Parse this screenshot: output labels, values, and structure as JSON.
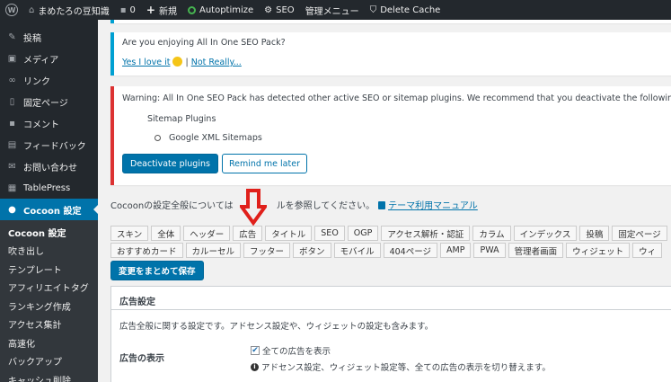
{
  "adminbar": {
    "site_name": "まめたろの豆知識",
    "comments_count": "0",
    "new_label": "新規",
    "autoptimize_label": "Autoptimize",
    "seo_label": "SEO",
    "admin_menu_label": "管理メニュー",
    "delete_cache_label": "Delete Cache"
  },
  "sidebar": {
    "items": [
      {
        "label": "投稿",
        "icon": "pin-icon"
      },
      {
        "label": "メディア",
        "icon": "media-icon"
      },
      {
        "label": "リンク",
        "icon": "link-icon"
      },
      {
        "label": "固定ページ",
        "icon": "page-icon"
      },
      {
        "label": "コメント",
        "icon": "comment-icon"
      },
      {
        "label": "フィードバック",
        "icon": "feedback-icon"
      },
      {
        "label": "お問い合わせ",
        "icon": "mail-icon"
      },
      {
        "label": "TablePress",
        "icon": "table-icon"
      },
      {
        "label": "Cocoon 設定",
        "icon": "cocoon-icon"
      }
    ],
    "submenu": [
      "Cocoon 設定",
      "吹き出し",
      "テンプレート",
      "アフィリエイトタグ",
      "ランキング作成",
      "アクセス集計",
      "高速化",
      "バックアップ",
      "キャッシュ削除"
    ]
  },
  "notice_seo": {
    "question": "Are you enjoying All In One SEO Pack?",
    "yes_link": "Yes I love it",
    "separator": "|",
    "no_link": "Not Really..."
  },
  "notice_warning": {
    "text": "Warning: All In One SEO Pack has detected other active SEO or sitemap plugins. We recommend that you deactivate the following plugins t",
    "heading": "Sitemap Plugins",
    "plugin": "Google XML Sitemaps",
    "deactivate_btn": "Deactivate plugins",
    "remind_btn": "Remind me later"
  },
  "manual": {
    "text": "Cocoonの設定全般については",
    "tail": "ルを参照してください。",
    "link": "テーマ利用マニュアル"
  },
  "tabs_row1": [
    "スキン",
    "全体",
    "ヘッダー",
    "広告",
    "タイトル",
    "SEO",
    "OGP",
    "アクセス解析・認証",
    "カラム",
    "インデックス",
    "投稿",
    "固定ページ"
  ],
  "tabs_row2": [
    "おすすめカード",
    "カルーセル",
    "フッター",
    "ボタン",
    "モバイル",
    "404ページ",
    "AMP",
    "PWA",
    "管理者画面",
    "ウィジェット",
    "ウィ"
  ],
  "save_button": "変更をまとめて保存",
  "panel": {
    "title": "広告設定",
    "description": "広告全般に関する設定です。アドセンス設定や、ウィジェットの設定も含みます。",
    "setting_label": "広告の表示",
    "checkbox_label": "全ての広告を表示",
    "checkbox_checked": true,
    "info_text": "アドセンス設定、ウィジェット設定等、全ての広告の表示を切り替えます。"
  },
  "colors": {
    "accent": "#0073aa",
    "sidebar_bg": "#23282d",
    "warning": "#dc3232",
    "arrow": "#e0201b"
  }
}
